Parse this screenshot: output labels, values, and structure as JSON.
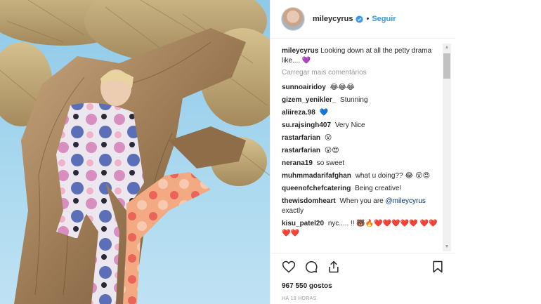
{
  "post": {
    "username": "mileycyrus",
    "follow_label": "Seguir",
    "separator": "•",
    "load_more": "Carregar mais comentários",
    "likes": "967 550 gostos",
    "time": "HÁ 19 HORAS"
  },
  "caption": {
    "user": "mileycyrus",
    "text": "Looking down at all the petty drama like....",
    "emoji": "💜"
  },
  "comments": [
    {
      "user": "sunnoairidoy",
      "text": "",
      "emoji": "😂😂😂"
    },
    {
      "user": "gizem_yenikler_",
      "text": "Stunning",
      "emoji": ""
    },
    {
      "user": "aliireza.98",
      "text": "",
      "emoji": "💙"
    },
    {
      "user": "su.rajsingh407",
      "text": "Very Nice",
      "emoji": ""
    },
    {
      "user": "rastarfarian",
      "text": "",
      "emoji": "😮"
    },
    {
      "user": "rastarfarian",
      "text": "",
      "emoji": "😮😍"
    },
    {
      "user": "nerana19",
      "text": "so sweet",
      "emoji": ""
    },
    {
      "user": "muhmmadarifafghan",
      "text": "what u doing??",
      "emoji": "😂 😮😍"
    },
    {
      "user": "queenofchefcatering",
      "text": "Being creative!",
      "emoji": ""
    },
    {
      "user": "thewisdomheart",
      "text": "When you are",
      "mention": "@mileycyrus",
      "after": "exactly",
      "emoji": ""
    },
    {
      "user": "kisu_patel20",
      "text": "nyc..... !!",
      "emoji": "🐻🔥❤️❤️❤️❤️❤️ ❤️❤️❤️❤️"
    }
  ],
  "icons": {
    "like": "heart-icon",
    "comment": "comment-icon",
    "share": "share-icon",
    "save": "bookmark-icon",
    "verified": "verified-badge-icon"
  },
  "colors": {
    "follow": "#3897f0",
    "verified": "#3897f0",
    "sky": "#9dd3ee",
    "muted": "#999999"
  }
}
